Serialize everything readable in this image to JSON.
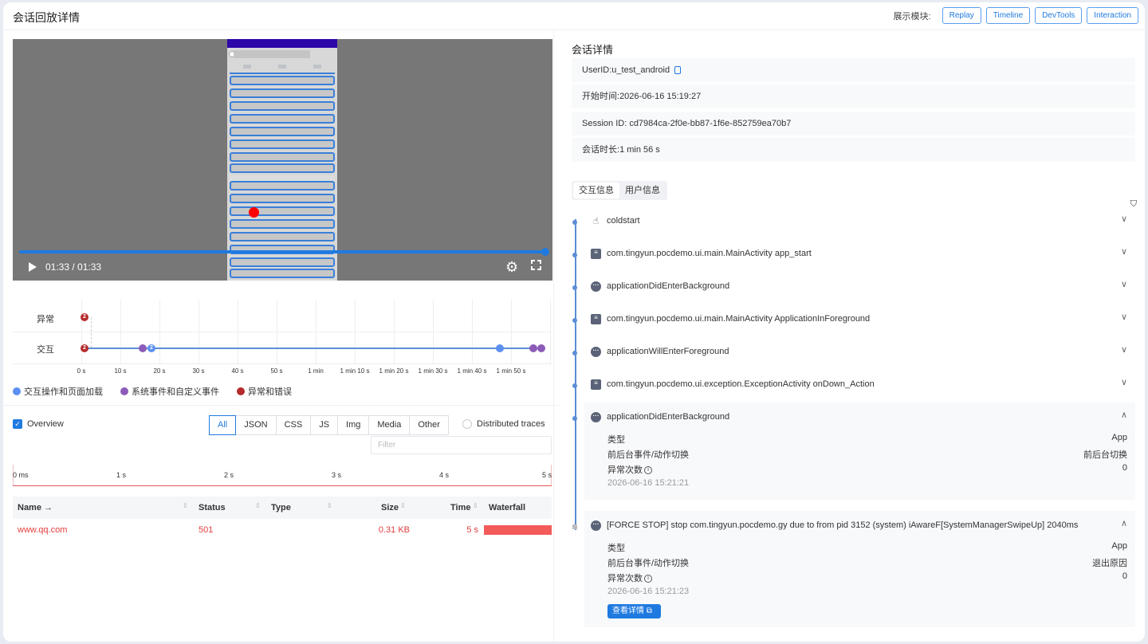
{
  "header": {
    "title": "会话回放详情",
    "modules_label": "展示模块:",
    "modules": [
      "Replay",
      "Timeline",
      "DevTools",
      "Interaction"
    ]
  },
  "video": {
    "time": "01:33 / 01:33",
    "progress": 1.0
  },
  "timeline": {
    "rows": [
      "异常",
      "交互"
    ],
    "ticks": [
      "0 s",
      "10 s",
      "20 s",
      "30 s",
      "40 s",
      "50 s",
      "1 min",
      "1 min 10 s",
      "1 min 20 s",
      "1 min 30 s",
      "1 min 40 s",
      "1 min 50 s"
    ],
    "badges": {
      "error_count": "2",
      "interaction_error_count": "2",
      "interaction_blue_count": "2"
    },
    "legend": [
      {
        "label": "交互操作和页面加载",
        "color": "#5b8ff0"
      },
      {
        "label": "系统事件和自定义事件",
        "color": "#8c5bb8"
      },
      {
        "label": "异常和错误",
        "color": "#b52b2b"
      }
    ]
  },
  "network": {
    "overview_label": "Overview",
    "filters": [
      "All",
      "JSON",
      "CSS",
      "JS",
      "Img",
      "Media",
      "Other"
    ],
    "distributed_label": "Distributed traces",
    "filter_placeholder": "Filter",
    "ruler": [
      "0 ms",
      "1 s",
      "2 s",
      "3 s",
      "4 s",
      "5 s"
    ],
    "columns": {
      "name": "Name →",
      "status": "Status",
      "type": "Type",
      "size": "Size",
      "time": "Time",
      "waterfall": "Waterfall"
    },
    "rows": [
      {
        "name": "www.qq.com",
        "status": "501",
        "type": "",
        "size": "0.31 KB",
        "time": "5 s"
      }
    ]
  },
  "session": {
    "title": "会话详情",
    "user_id_label": "UserID:",
    "user_id": "u_test_android",
    "start_label": "开始时间:",
    "start": "2026-06-16 15:19:27",
    "session_label": "Session ID:",
    "session_id": "cd7984ca-2f0e-bb87-1f6e-852759ea70b7",
    "duration_label": "会话时长:",
    "duration": "1 min 56 s"
  },
  "tabs": [
    "交互信息",
    "用户信息"
  ],
  "events": [
    {
      "icon": "hand-icon",
      "text": "coldstart"
    },
    {
      "icon": "document-icon",
      "text": "com.tingyun.pocdemo.ui.main.MainActivity app_start"
    },
    {
      "icon": "more-icon",
      "text": "applicationDidEnterBackground"
    },
    {
      "icon": "document-icon",
      "text": "com.tingyun.pocdemo.ui.main.MainActivity ApplicationInForeground"
    },
    {
      "icon": "more-icon",
      "text": "applicationWillEnterForeground"
    },
    {
      "icon": "document-icon",
      "text": "com.tingyun.pocdemo.ui.exception.ExceptionActivity onDown_Action"
    }
  ],
  "expanded": [
    {
      "text": "applicationDidEnterBackground",
      "type_label": "类型",
      "type": "App",
      "event_label": "前后台事件/动作切换",
      "event": "前后台切换",
      "count_label": "异常次数",
      "count": "0",
      "time": "2026-06-16 15:21:21"
    },
    {
      "text": "[FORCE STOP] stop com.tingyun.pocdemo.gy due to from pid 3152 (system) iAwareF[SystemManagerSwipeUp] 2040ms",
      "type_label": "类型",
      "type": "App",
      "event_label": "前后台事件/动作切换",
      "event": "退出原因",
      "count_label": "异常次数",
      "count": "0",
      "time": "2026-06-16 15:21:23",
      "button": "查看详情"
    }
  ]
}
